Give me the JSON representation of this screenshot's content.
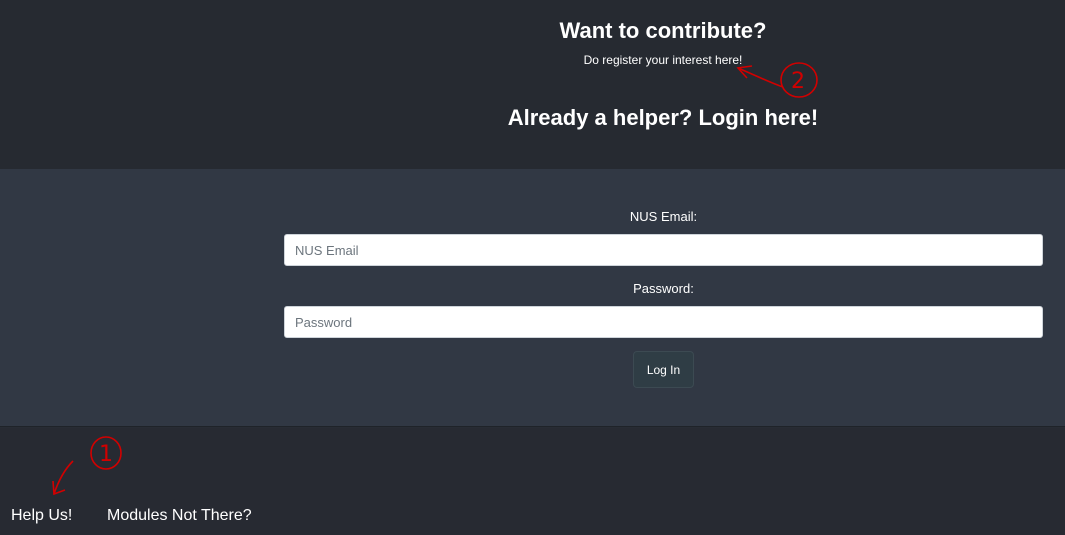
{
  "hero": {
    "contribute_title": "Want to contribute?",
    "register_prefix": "Do register your interest ",
    "register_link": "here!",
    "login_title": "Already a helper? Login here!"
  },
  "form": {
    "email_label": "NUS Email:",
    "email_placeholder": "NUS Email",
    "email_value": "",
    "password_label": "Password:",
    "password_placeholder": "Password",
    "password_value": "",
    "login_button": "Log In"
  },
  "footer": {
    "help_link": "Help Us!",
    "modules_link": "Modules Not There?"
  },
  "annotations": {
    "marker_1": "1",
    "marker_2": "2",
    "color": "#d20000"
  }
}
